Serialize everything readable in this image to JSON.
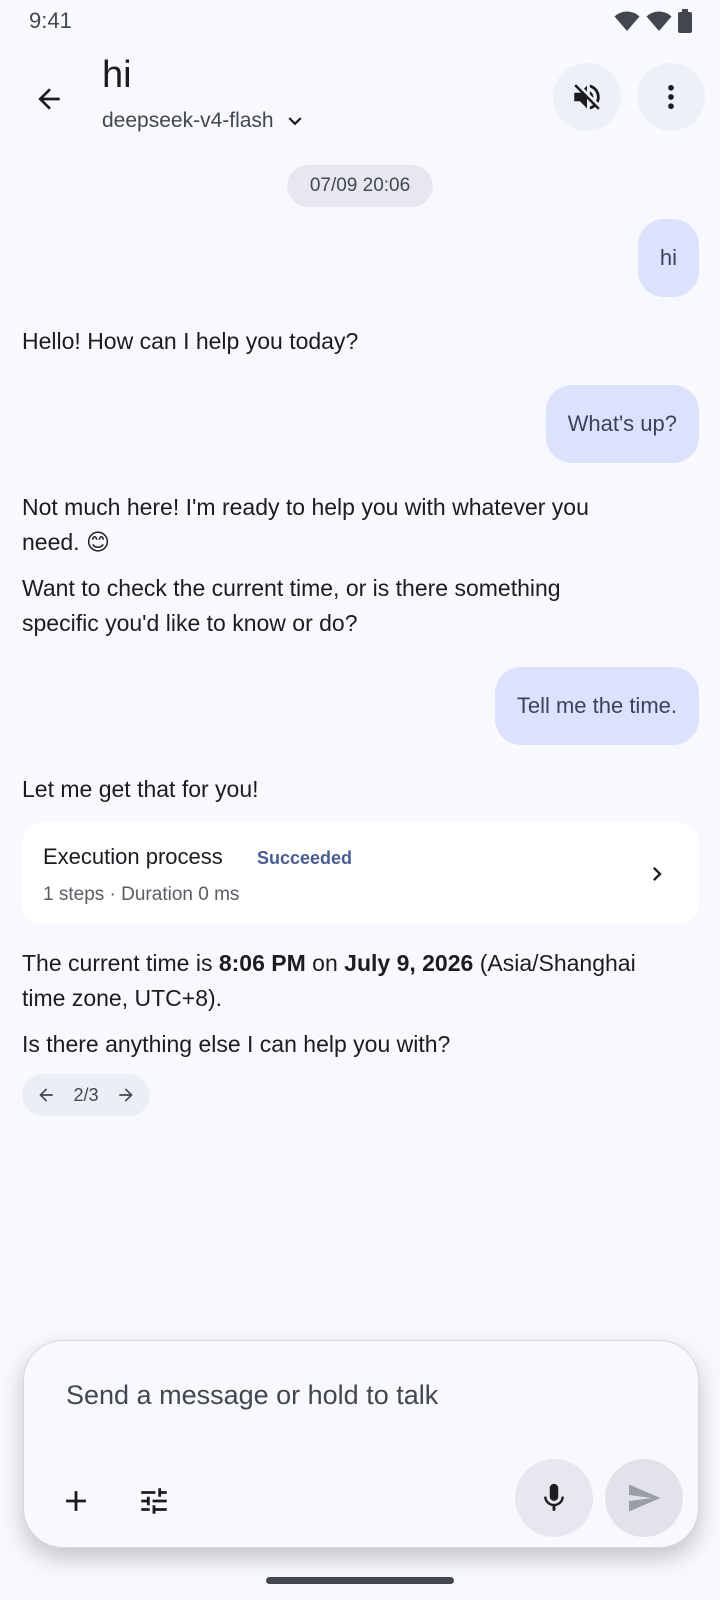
{
  "status_bar": {
    "time": "9:41"
  },
  "header": {
    "title": "hi",
    "model": "deepseek-v4-flash"
  },
  "timestamp": "07/09 20:06",
  "messages": {
    "user_1": "hi",
    "assistant_1": "Hello! How can I help you today?",
    "user_2": "What's up?",
    "assistant_2_p1_line1": "Not much here! I'm ready to help you with whatever you",
    "assistant_2_p1_line2": "need. 😊",
    "assistant_2_p2_line1": "Want to check the current time, or is there something",
    "assistant_2_p2_line2": "specific you'd like to know or do?",
    "user_3": "Tell me the time.",
    "assistant_3_intro": "Let me get that for you!",
    "assistant_3_time_prefix": "The current time is ",
    "assistant_3_time_value": "8:06 PM",
    "assistant_3_time_mid": " on ",
    "assistant_3_date_value": "July 9, 2026",
    "assistant_3_time_suffix": " (Asia/Shanghai",
    "assistant_3_line2": "time zone, UTC+8).",
    "assistant_3_followup": "Is there anything else I can help you with?"
  },
  "execution": {
    "title": "Execution process",
    "status": "Succeeded",
    "meta": "1 steps · Duration 0 ms"
  },
  "pager": {
    "label": "2/3"
  },
  "composer": {
    "placeholder": "Send a message or hold to talk"
  },
  "colors": {
    "background": "#f8f9ff",
    "user_bubble": "#dce2fb",
    "accent": "#4b5c92"
  }
}
